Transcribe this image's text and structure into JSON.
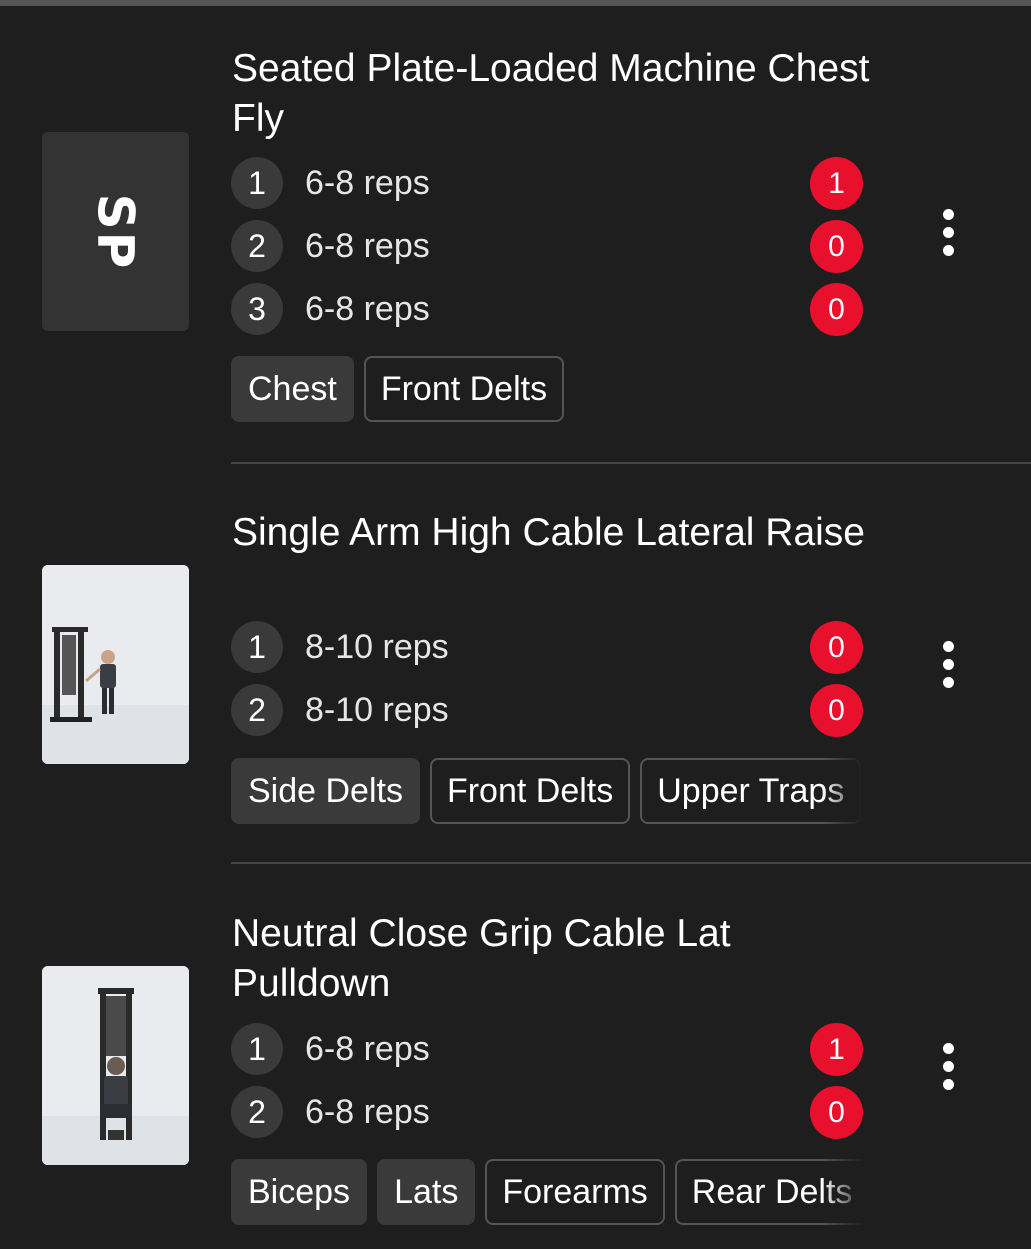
{
  "exercises": [
    {
      "title": "Seated Plate-Loaded Machine Chest Fly",
      "thumbnail_text": "SP",
      "sets": [
        {
          "number": "1",
          "reps": "6-8 reps",
          "badge": "1"
        },
        {
          "number": "2",
          "reps": "6-8 reps",
          "badge": "0"
        },
        {
          "number": "3",
          "reps": "6-8 reps",
          "badge": "0"
        }
      ],
      "muscles": [
        {
          "label": "Chest",
          "primary": true
        },
        {
          "label": "Front Delts",
          "primary": false
        }
      ]
    },
    {
      "title": "Single Arm High Cable Lateral Raise",
      "sets": [
        {
          "number": "1",
          "reps": "8-10 reps",
          "badge": "0"
        },
        {
          "number": "2",
          "reps": "8-10 reps",
          "badge": "0"
        }
      ],
      "muscles": [
        {
          "label": "Side Delts",
          "primary": true
        },
        {
          "label": "Front Delts",
          "primary": false
        },
        {
          "label": "Upper Traps",
          "primary": false
        }
      ]
    },
    {
      "title": "Neutral Close Grip Cable Lat Pulldown",
      "sets": [
        {
          "number": "1",
          "reps": "6-8 reps",
          "badge": "1"
        },
        {
          "number": "2",
          "reps": "6-8 reps",
          "badge": "0"
        }
      ],
      "muscles": [
        {
          "label": "Biceps",
          "primary": true
        },
        {
          "label": "Lats",
          "primary": true
        },
        {
          "label": "Forearms",
          "primary": false
        },
        {
          "label": "Rear Delts",
          "primary": false
        }
      ]
    }
  ],
  "icons": {
    "menu": "more-vertical-icon"
  },
  "colors": {
    "background": "#1e1e1e",
    "badge": "#e8102c",
    "chip": "#3a3a3a"
  }
}
